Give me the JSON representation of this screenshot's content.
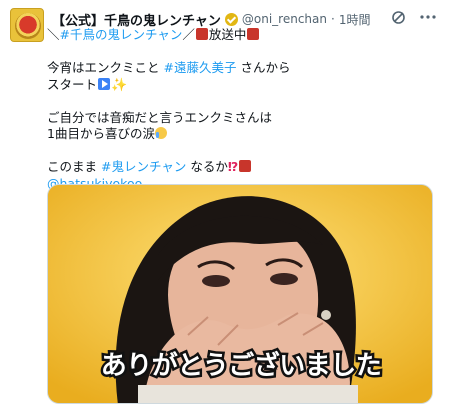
{
  "tweet": {
    "display_name": "【公式】千鳥の鬼レンチャン",
    "handle": "@oni_renchan",
    "separator": "·",
    "time": "1時間",
    "lines": {
      "l1_prefix": "＼",
      "l1_hashtag": "#千鳥の鬼レンチャン",
      "l1_slash": "／",
      "l1_text": "放送中",
      "l2_text": "今宵はエンクミこと ",
      "l2_mention": "#遠藤久美子",
      "l2_suffix": " さんから",
      "l3_text": "スタート",
      "l4_text": "ご自分では音痴だと言うエンクミさんは",
      "l5_text": "1曲目から喜びの涙",
      "l6_text": "このまま ",
      "l6_hashtag": "#鬼レンチャン",
      "l6_suffix": " なるか",
      "l6_marks": "⁉",
      "l7_link": "@hatsukiyokoo"
    },
    "media": {
      "caption": "ありがとうございました"
    }
  },
  "icons": {
    "avatar": "program-logo",
    "verified": "verified-badge-icon",
    "grok": "slash-circle-icon",
    "more": "more-dots-icon",
    "sparkle": "sparkle-icon",
    "play": "play-button-icon",
    "cry": "crying-face-icon",
    "oni": "red-oni-icon"
  },
  "colors": {
    "link": "#1d9bf0",
    "text": "#0f1419",
    "secondary": "#536471",
    "verified_gold": "#e2b714",
    "media_background": "#f0c443"
  }
}
